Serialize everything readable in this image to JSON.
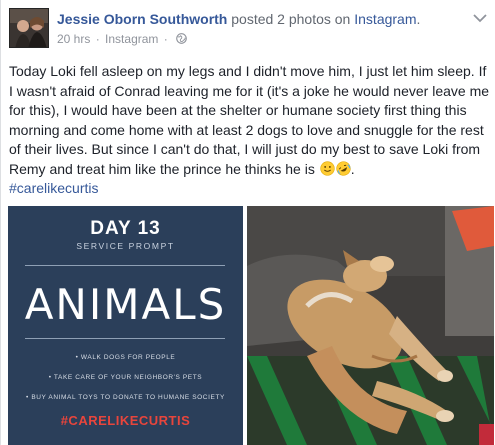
{
  "post": {
    "author": "Jessie Oborn Southworth",
    "action_text": "posted 2 photos on",
    "platform": "Instagram",
    "period": ".",
    "timestamp": "20 hrs",
    "source": "Instagram",
    "separator": "·",
    "privacy_icon": "globe-icon",
    "menu_icon": "chevron-down-icon",
    "body": "Today Loki fell asleep on my legs and I didn't move him, I just let him sleep. If I wasn't afraid of Conrad leaving me for it (it's a joke he would never leave me for this), I would have been at the shelter or humane society first thing this morning and come home with at least 2 dogs to love and snuggle for the rest of their lives. But since I can't do that, I will just do my best to save Loki from Remy and treat him like the prince he thinks he is",
    "body_end": ".",
    "emojis": [
      "slightly-smiling-face-icon",
      "rolling-on-floor-laughing-icon"
    ],
    "hashtag": "#carelikecurtis"
  },
  "photo_left": {
    "day": "DAY 13",
    "subtitle": "SERVICE PROMPT",
    "headline": "ANIMALS",
    "bullets": [
      "• WALK DOGS FOR PEOPLE",
      "• TAKE CARE OF YOUR NEIGHBOR'S PETS",
      "• BUY ANIMAL TOYS TO DONATE TO HUMANE SOCIETY"
    ],
    "hashtag": "#CARELIKECURTIS"
  },
  "colors": {
    "link": "#365899",
    "meta": "#90949c",
    "poster_bg": "#2b3f5a",
    "poster_accent": "#e8453c"
  }
}
